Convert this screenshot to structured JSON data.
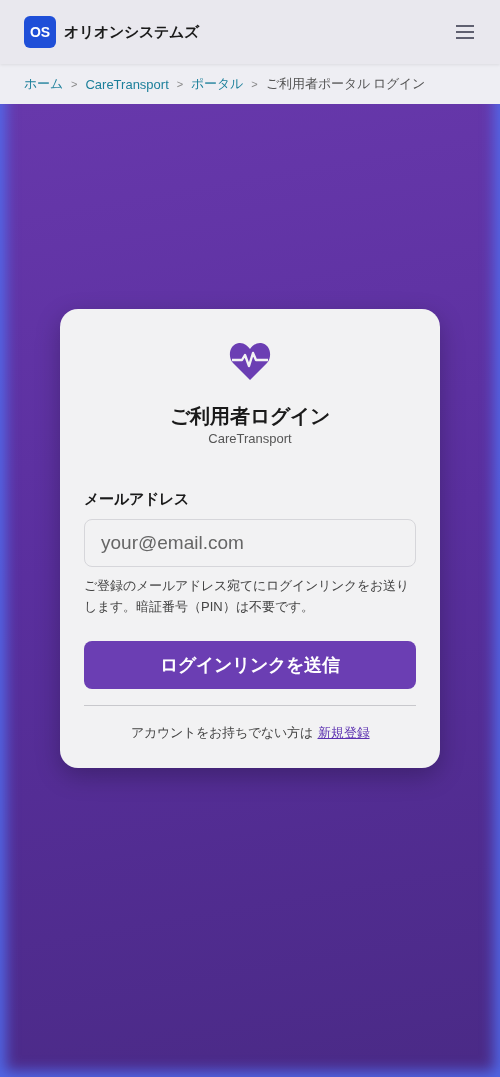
{
  "header": {
    "logo": "OS",
    "brand": "オリオンシステムズ"
  },
  "breadcrumb": [
    {
      "kind": "link",
      "text": "ホーム"
    },
    {
      "kind": "separator",
      "text": ">"
    },
    {
      "kind": "link",
      "text": "CareTransport"
    },
    {
      "kind": "separator",
      "text": ">"
    },
    {
      "kind": "link",
      "text": "ポータル"
    },
    {
      "kind": "separator",
      "text": ">"
    },
    {
      "kind": "current",
      "text": "ご利用者ポータル ログイン"
    }
  ],
  "login": {
    "title": "ご利用者ログイン",
    "subtitle": "CareTransport",
    "email_label": "メールアドレス",
    "placeholder": "your@email.com",
    "help": "ご登録のメールアドレス宛てにログインリンクをお送りします。暗証番号（PIN）は不要です。",
    "submit": "ログインリンクを送信",
    "signup_prompt": "アカウントをお持ちでない方は",
    "signup_link": "新規登録"
  }
}
